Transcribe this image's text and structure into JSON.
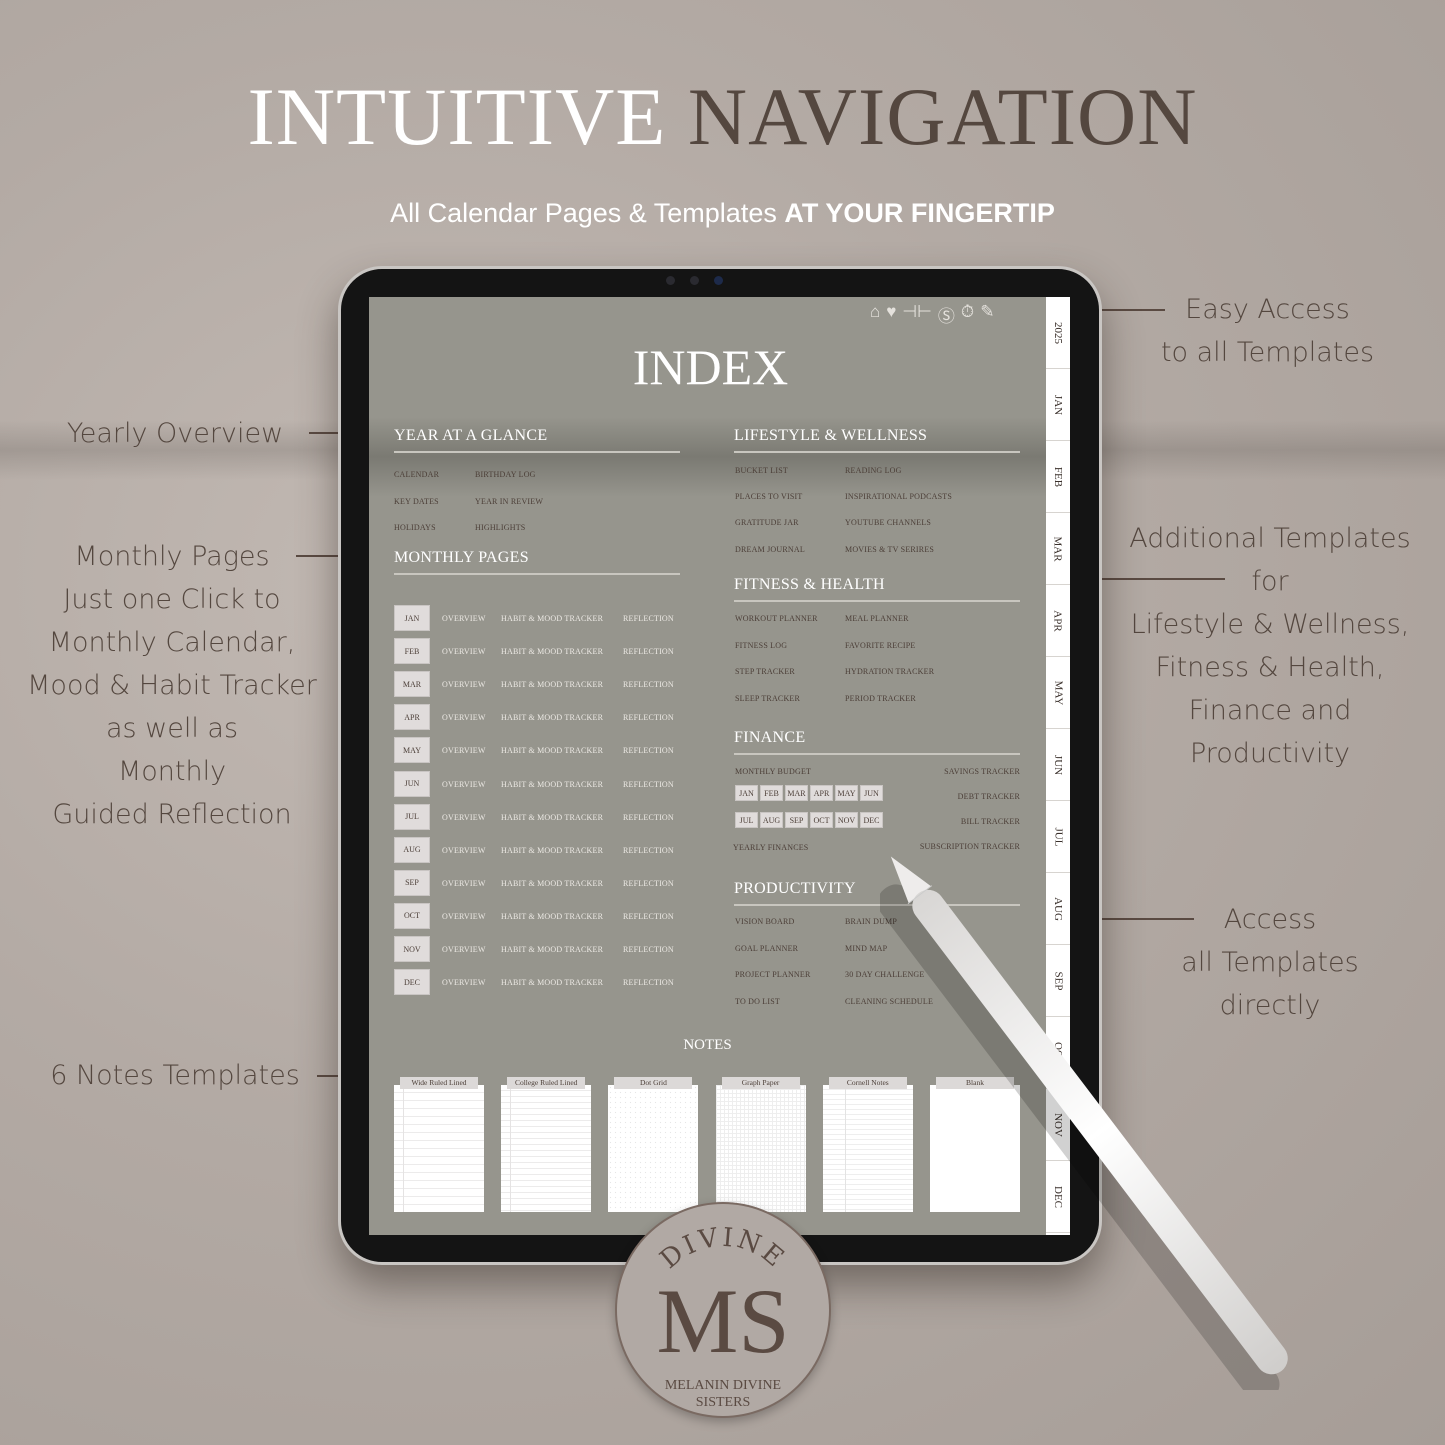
{
  "header": {
    "title_light": "INTUITIVE",
    "title_dark": "NAVIGATION",
    "subtitle_regular": "All Calendar Pages & Templates",
    "subtitle_bold": "AT YOUR FINGERTIP"
  },
  "annotations": {
    "yearly": "Yearly Overview",
    "monthly": [
      "Monthly Pages",
      "Just one Click to",
      "Monthly Calendar,",
      "Mood & Habit Tracker",
      "as well as",
      "Monthly",
      "Guided Reflection"
    ],
    "notes": "6 Notes Templates",
    "easy": [
      "Easy Access",
      "to all Templates"
    ],
    "additional": [
      "Additional Templates",
      "for",
      "Lifestyle & Wellness,",
      "Fitness & Health,",
      "Finance and",
      "Productivity"
    ],
    "access": [
      "Access",
      "all Templates",
      "directly"
    ]
  },
  "toolbar": {
    "icons": [
      "home-icon",
      "heart-icon",
      "dumbbell-icon",
      "dollar-coin-icon",
      "stopwatch-icon",
      "pencil-icon"
    ]
  },
  "side_tabs": [
    "2025",
    "JAN",
    "FEB",
    "MAR",
    "APR",
    "MAY",
    "JUN",
    "JUL",
    "AUG",
    "SEP",
    "OCT",
    "NOV",
    "DEC"
  ],
  "index": {
    "title": "INDEX",
    "year_at_a_glance": {
      "heading": "YEAR AT A GLANCE",
      "items": [
        "CALENDAR",
        "BIRTHDAY LOG",
        "KEY DATES",
        "YEAR IN REVIEW",
        "HOLIDAYS",
        "HIGHLIGHTS"
      ]
    },
    "monthly_pages": {
      "heading": "MONTHLY PAGES",
      "months": [
        "JAN",
        "FEB",
        "MAR",
        "APR",
        "MAY",
        "JUN",
        "JUL",
        "AUG",
        "SEP",
        "OCT",
        "NOV",
        "DEC"
      ],
      "links": [
        "OVERVIEW",
        "HABIT & MOOD TRACKER",
        "REFLECTION"
      ]
    },
    "lifestyle": {
      "heading": "LIFESTYLE & WELLNESS",
      "items": [
        "BUCKET LIST",
        "READING LOG",
        "PLACES TO VISIT",
        "INSPIRATIONAL PODCASTS",
        "GRATITUDE JAR",
        "YOUTUBE CHANNELS",
        "DREAM JOURNAL",
        "MOVIES & TV SERIRES"
      ]
    },
    "fitness": {
      "heading": "FITNESS & HEALTH",
      "items": [
        "WORKOUT PLANNER",
        "MEAL PLANNER",
        "FITNESS LOG",
        "FAVORITE RECIPE",
        "STEP TRACKER",
        "HYDRATION TRACKER",
        "SLEEP TRACKER",
        "PERIOD TRACKER"
      ]
    },
    "finance": {
      "heading": "FINANCE",
      "budget": "MONTHLY BUDGET",
      "months": [
        "JAN",
        "FEB",
        "MAR",
        "APR",
        "MAY",
        "JUN",
        "JUL",
        "AUG",
        "SEP",
        "OCT",
        "NOV",
        "DEC"
      ],
      "yearly": "YEARLY FINANCES",
      "right": [
        "SAVINGS TRACKER",
        "DEBT TRACKER",
        "BILL TRACKER",
        "SUBSCRIPTION TRACKER"
      ]
    },
    "productivity": {
      "heading": "PRODUCTIVITY",
      "items": [
        "VISION BOARD",
        "BRAIN DUMP",
        "GOAL PLANNER",
        "MIND MAP",
        "PROJECT PLANNER",
        "30 DAY CHALLENGE",
        "TO DO LIST",
        "CLEANING SCHEDULE"
      ]
    },
    "notes": {
      "heading": "NOTES",
      "templates": [
        "Wide Ruled Lined",
        "College Ruled Lined",
        "Dot Grid",
        "Graph Paper",
        "Cornell Notes",
        "Blank"
      ]
    }
  },
  "logo": {
    "top": "DIVINE",
    "monogram": "MS",
    "name": "MELANIN DIVINE",
    "name2": "SISTERS"
  },
  "colors": {
    "background": "#b3aaa4",
    "brown": "#54473f",
    "screen": "#96958d",
    "month_box": "#e0dcdb"
  }
}
